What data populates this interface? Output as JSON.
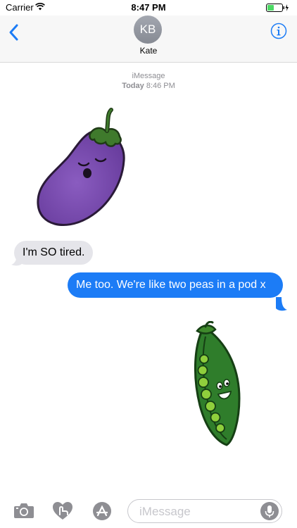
{
  "status_bar": {
    "carrier": "Carrier",
    "time": "8:47 PM",
    "icons": [
      "wifi-icon",
      "battery-icon"
    ]
  },
  "nav": {
    "avatar_initials": "KB",
    "contact_name": "Kate",
    "icons": [
      "chevron-left-icon",
      "info-icon"
    ]
  },
  "conversation": {
    "service": "iMessage",
    "date_label": "Today",
    "time": "8:46 PM",
    "messages": [
      {
        "type": "sticker",
        "sender": "incoming",
        "sticker": "sleeping-eggplant"
      },
      {
        "type": "text",
        "sender": "incoming",
        "text": "I'm SO tired."
      },
      {
        "type": "text",
        "sender": "outgoing",
        "text": "Me too. We're like two peas in a pod x"
      },
      {
        "type": "sticker",
        "sender": "outgoing",
        "sticker": "smiling-pea-pod"
      }
    ]
  },
  "composer": {
    "placeholder": "iMessage",
    "value": "",
    "icons": [
      "camera-icon",
      "digital-touch-icon",
      "app-store-icon",
      "microphone-icon"
    ]
  },
  "colors": {
    "accent": "#1c7cf6",
    "incoming_bubble": "#e5e5ea",
    "outgoing_bubble": "#1c7cf6",
    "gray": "#8e8e93"
  }
}
